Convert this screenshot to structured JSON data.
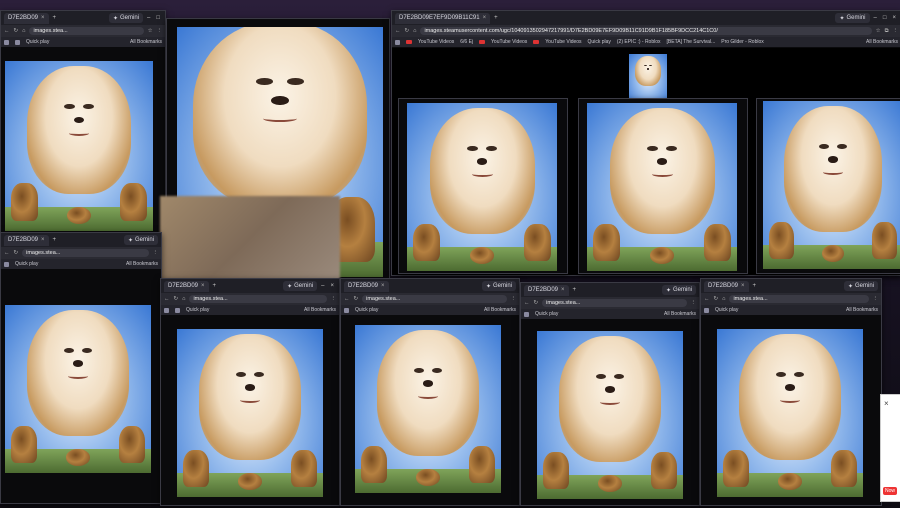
{
  "browser": {
    "tab_short": "D7E2BD09",
    "tab_wide": "D7E2BD09E7EF9D09B11C91",
    "new_tab": "+",
    "close_tab": "×",
    "gemini": "Gemini",
    "url_short": "images.stea...",
    "url_wide": "images.steamusercontent.com/ugc/1040913502947217991/D7E2BD09E7EF9D09B11C91D9B1F185BF9DCC214C1C0/",
    "bookmark_quick_play": "Quick play",
    "bookmark_all": "All Bookmarks",
    "bookmarks_wide": [
      "YouTube Videos",
      "6/6 Ej",
      "YouTube Videos",
      "YouTube Videos",
      "(2) EPIC :) - Roblox",
      "[BETA] The Survival...",
      "Pro Gilder - Roblox"
    ],
    "window_controls": [
      "–",
      "□",
      "×"
    ]
  },
  "notification": {
    "tag": "Now"
  },
  "colors": {
    "accent": "#3a78d4",
    "window_bg": "#0a0a0c",
    "tabbar": "#1f1f26"
  }
}
